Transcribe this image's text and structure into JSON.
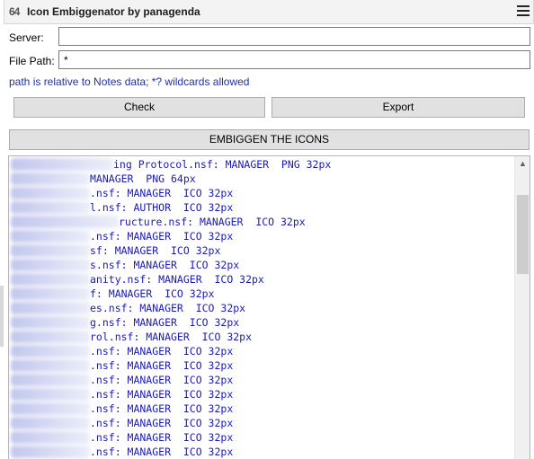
{
  "window": {
    "app_icon_text": "64",
    "title": "Icon Embiggenator by panagenda",
    "menu_icon": "hamburger-menu-icon"
  },
  "form": {
    "server_label": "Server:",
    "server_value": "",
    "path_label": "File Path:",
    "path_value": "*",
    "hint": "path is relative to Notes data; *? wildcards allowed"
  },
  "buttons": {
    "check": "Check",
    "export": "Export",
    "embiggen": "EMBIGGEN THE ICONS"
  },
  "output": {
    "lines": [
      "ing Protocol.nsf: MANAGER  PNG 32px",
      "MANAGER  PNG 64px",
      ".nsf: MANAGER  ICO 32px",
      "l.nsf: AUTHOR  ICO 32px",
      "ructure.nsf: MANAGER  ICO 32px",
      ".nsf: MANAGER  ICO 32px",
      "sf: MANAGER  ICO 32px",
      "s.nsf: MANAGER  ICO 32px",
      "anity.nsf: MANAGER  ICO 32px",
      "f: MANAGER  ICO 32px",
      "es.nsf: MANAGER  ICO 32px",
      "g.nsf: MANAGER  ICO 32px",
      "rol.nsf: MANAGER  ICO 32px",
      ".nsf: MANAGER  ICO 32px",
      ".nsf: MANAGER  ICO 32px",
      ".nsf: MANAGER  ICO 32px",
      ".nsf: MANAGER  ICO 32px",
      ".nsf: MANAGER  ICO 32px",
      ".nsf: MANAGER  ICO 32px",
      ".nsf: MANAGER  ICO 32px",
      ".nsf: MANAGER  ICO 32px"
    ],
    "scroll_up_icon": "scroll-up-arrow-icon"
  },
  "colors": {
    "output_text": "#1a1ab8",
    "hint_text": "#1f2fb3",
    "button_face": "#e1e1e1"
  }
}
